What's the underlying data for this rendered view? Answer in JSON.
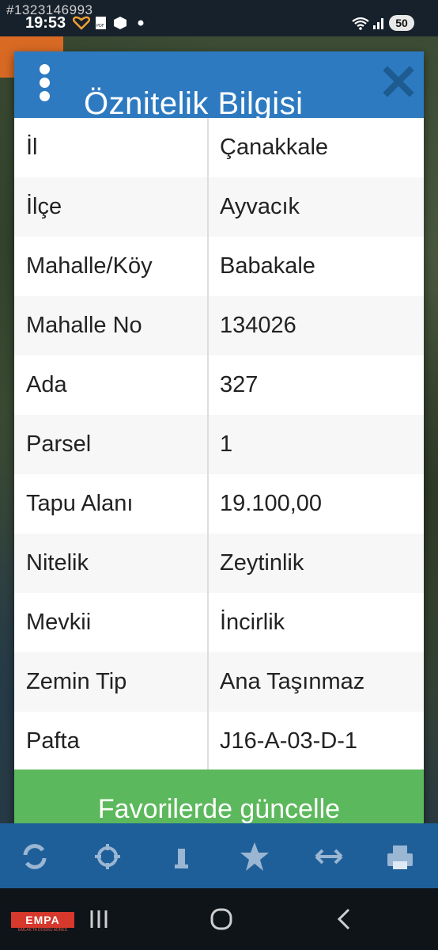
{
  "status_bar": {
    "watermark": "#1323146993",
    "time": "19:53",
    "battery": "50"
  },
  "dialog": {
    "title": "Öznitelik Bilgisi",
    "rows": [
      {
        "key": "İl",
        "value": "Çanakkale"
      },
      {
        "key": "İlçe",
        "value": "Ayvacık"
      },
      {
        "key": "Mahalle/Köy",
        "value": "Babakale"
      },
      {
        "key": "Mahalle No",
        "value": "134026"
      },
      {
        "key": "Ada",
        "value": "327"
      },
      {
        "key": "Parsel",
        "value": "1"
      },
      {
        "key": "Tapu Alanı",
        "value": "19.100,00"
      },
      {
        "key": "Nitelik",
        "value": "Zeytinlik"
      },
      {
        "key": "Mevkii",
        "value": "İncirlik"
      },
      {
        "key": "Zemin Tip",
        "value": "Ana Taşınmaz"
      },
      {
        "key": "Pafta",
        "value": "J16-A-03-D-1"
      }
    ],
    "action_label": "Favorilerde güncelle",
    "colors": {
      "header": "#2d7ac0",
      "action": "#5cb85c"
    }
  },
  "toolbar": {
    "icons": [
      "refresh-icon",
      "crosshair-icon",
      "info-icon",
      "star-icon",
      "measure-icon",
      "print-icon"
    ],
    "color": "#1f5f99"
  },
  "branding": {
    "logo_text": "EMPA",
    "logo_subtitle": "EMLAK'TA DOĞRU ADRES"
  },
  "nav": {
    "icons": [
      "recent-apps-icon",
      "home-icon",
      "back-icon"
    ]
  }
}
